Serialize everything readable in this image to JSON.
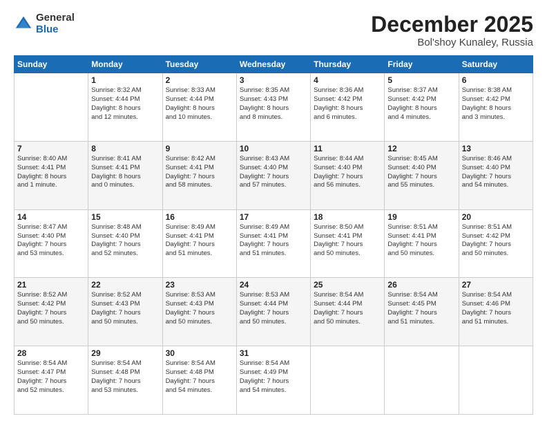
{
  "logo": {
    "general": "General",
    "blue": "Blue"
  },
  "header": {
    "month": "December 2025",
    "location": "Bol'shoy Kunaley, Russia"
  },
  "weekdays": [
    "Sunday",
    "Monday",
    "Tuesday",
    "Wednesday",
    "Thursday",
    "Friday",
    "Saturday"
  ],
  "weeks": [
    [
      {
        "day": "",
        "data": ""
      },
      {
        "day": "1",
        "data": "Sunrise: 8:32 AM\nSunset: 4:44 PM\nDaylight: 8 hours\nand 12 minutes."
      },
      {
        "day": "2",
        "data": "Sunrise: 8:33 AM\nSunset: 4:44 PM\nDaylight: 8 hours\nand 10 minutes."
      },
      {
        "day": "3",
        "data": "Sunrise: 8:35 AM\nSunset: 4:43 PM\nDaylight: 8 hours\nand 8 minutes."
      },
      {
        "day": "4",
        "data": "Sunrise: 8:36 AM\nSunset: 4:42 PM\nDaylight: 8 hours\nand 6 minutes."
      },
      {
        "day": "5",
        "data": "Sunrise: 8:37 AM\nSunset: 4:42 PM\nDaylight: 8 hours\nand 4 minutes."
      },
      {
        "day": "6",
        "data": "Sunrise: 8:38 AM\nSunset: 4:42 PM\nDaylight: 8 hours\nand 3 minutes."
      }
    ],
    [
      {
        "day": "7",
        "data": "Sunrise: 8:40 AM\nSunset: 4:41 PM\nDaylight: 8 hours\nand 1 minute."
      },
      {
        "day": "8",
        "data": "Sunrise: 8:41 AM\nSunset: 4:41 PM\nDaylight: 8 hours\nand 0 minutes."
      },
      {
        "day": "9",
        "data": "Sunrise: 8:42 AM\nSunset: 4:41 PM\nDaylight: 7 hours\nand 58 minutes."
      },
      {
        "day": "10",
        "data": "Sunrise: 8:43 AM\nSunset: 4:40 PM\nDaylight: 7 hours\nand 57 minutes."
      },
      {
        "day": "11",
        "data": "Sunrise: 8:44 AM\nSunset: 4:40 PM\nDaylight: 7 hours\nand 56 minutes."
      },
      {
        "day": "12",
        "data": "Sunrise: 8:45 AM\nSunset: 4:40 PM\nDaylight: 7 hours\nand 55 minutes."
      },
      {
        "day": "13",
        "data": "Sunrise: 8:46 AM\nSunset: 4:40 PM\nDaylight: 7 hours\nand 54 minutes."
      }
    ],
    [
      {
        "day": "14",
        "data": "Sunrise: 8:47 AM\nSunset: 4:40 PM\nDaylight: 7 hours\nand 53 minutes."
      },
      {
        "day": "15",
        "data": "Sunrise: 8:48 AM\nSunset: 4:40 PM\nDaylight: 7 hours\nand 52 minutes."
      },
      {
        "day": "16",
        "data": "Sunrise: 8:49 AM\nSunset: 4:41 PM\nDaylight: 7 hours\nand 51 minutes."
      },
      {
        "day": "17",
        "data": "Sunrise: 8:49 AM\nSunset: 4:41 PM\nDaylight: 7 hours\nand 51 minutes."
      },
      {
        "day": "18",
        "data": "Sunrise: 8:50 AM\nSunset: 4:41 PM\nDaylight: 7 hours\nand 50 minutes."
      },
      {
        "day": "19",
        "data": "Sunrise: 8:51 AM\nSunset: 4:41 PM\nDaylight: 7 hours\nand 50 minutes."
      },
      {
        "day": "20",
        "data": "Sunrise: 8:51 AM\nSunset: 4:42 PM\nDaylight: 7 hours\nand 50 minutes."
      }
    ],
    [
      {
        "day": "21",
        "data": "Sunrise: 8:52 AM\nSunset: 4:42 PM\nDaylight: 7 hours\nand 50 minutes."
      },
      {
        "day": "22",
        "data": "Sunrise: 8:52 AM\nSunset: 4:43 PM\nDaylight: 7 hours\nand 50 minutes."
      },
      {
        "day": "23",
        "data": "Sunrise: 8:53 AM\nSunset: 4:43 PM\nDaylight: 7 hours\nand 50 minutes."
      },
      {
        "day": "24",
        "data": "Sunrise: 8:53 AM\nSunset: 4:44 PM\nDaylight: 7 hours\nand 50 minutes."
      },
      {
        "day": "25",
        "data": "Sunrise: 8:54 AM\nSunset: 4:44 PM\nDaylight: 7 hours\nand 50 minutes."
      },
      {
        "day": "26",
        "data": "Sunrise: 8:54 AM\nSunset: 4:45 PM\nDaylight: 7 hours\nand 51 minutes."
      },
      {
        "day": "27",
        "data": "Sunrise: 8:54 AM\nSunset: 4:46 PM\nDaylight: 7 hours\nand 51 minutes."
      }
    ],
    [
      {
        "day": "28",
        "data": "Sunrise: 8:54 AM\nSunset: 4:47 PM\nDaylight: 7 hours\nand 52 minutes."
      },
      {
        "day": "29",
        "data": "Sunrise: 8:54 AM\nSunset: 4:48 PM\nDaylight: 7 hours\nand 53 minutes."
      },
      {
        "day": "30",
        "data": "Sunrise: 8:54 AM\nSunset: 4:48 PM\nDaylight: 7 hours\nand 54 minutes."
      },
      {
        "day": "31",
        "data": "Sunrise: 8:54 AM\nSunset: 4:49 PM\nDaylight: 7 hours\nand 54 minutes."
      },
      {
        "day": "",
        "data": ""
      },
      {
        "day": "",
        "data": ""
      },
      {
        "day": "",
        "data": ""
      }
    ]
  ]
}
